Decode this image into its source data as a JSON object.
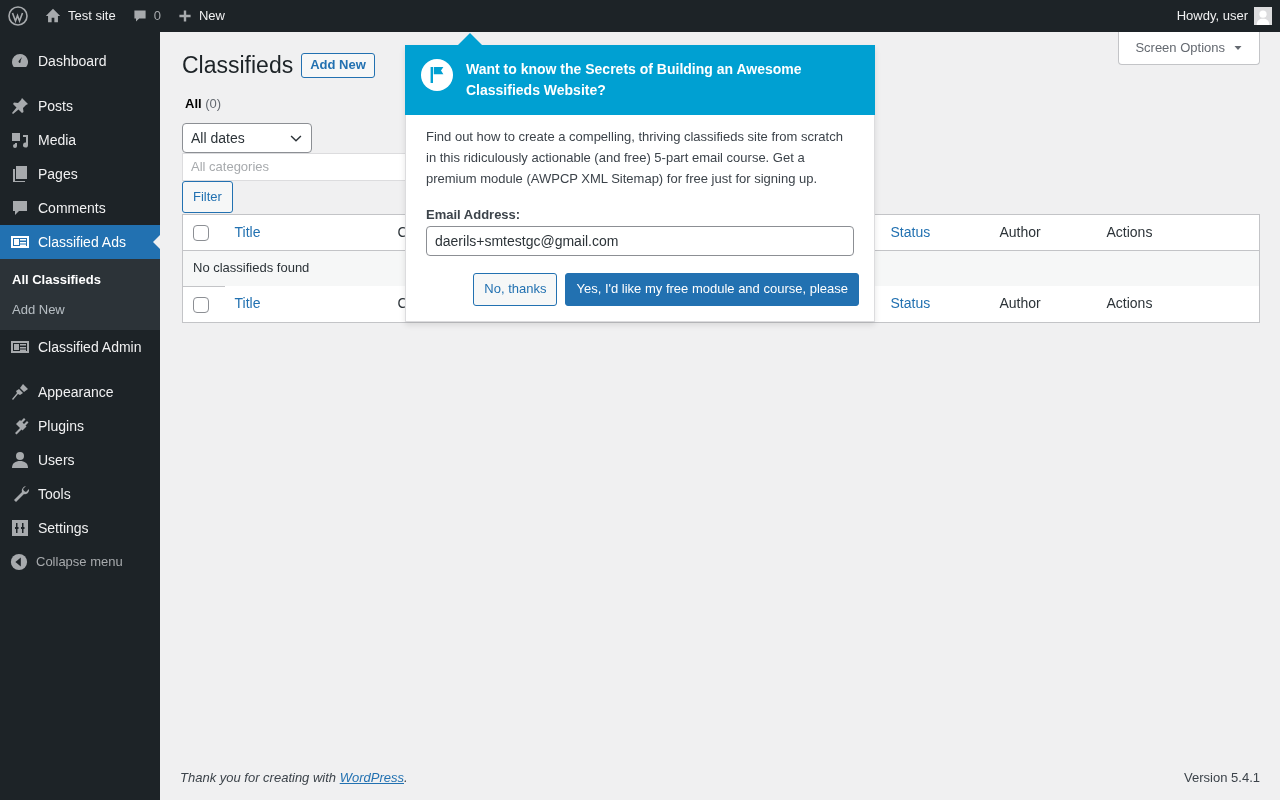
{
  "admin_bar": {
    "site": "Test site",
    "comments": "0",
    "new": "New",
    "greeting": "Howdy, user"
  },
  "menu": [
    {
      "label": "Dashboard",
      "selected": false,
      "gap_after": true
    },
    {
      "label": "Posts",
      "selected": false
    },
    {
      "label": "Media",
      "selected": false
    },
    {
      "label": "Pages",
      "selected": false
    },
    {
      "label": "Comments",
      "selected": false
    },
    {
      "label": "Classified Ads",
      "selected": true,
      "children": [
        {
          "label": "All Classifieds",
          "selected": true
        },
        {
          "label": "Add New",
          "selected": false
        }
      ]
    },
    {
      "label": "Classified Admin",
      "selected": false,
      "gap_after": true
    },
    {
      "label": "Appearance",
      "selected": false
    },
    {
      "label": "Plugins",
      "selected": false
    },
    {
      "label": "Users",
      "selected": false
    },
    {
      "label": "Tools",
      "selected": false
    },
    {
      "label": "Settings",
      "selected": false
    }
  ],
  "collapse_label": "Collapse menu",
  "screen_options": "Screen Options",
  "page": {
    "title": "Classifieds",
    "add_new": "Add New",
    "views": [
      {
        "label": "All",
        "count": "(0)",
        "selected": true
      }
    ],
    "date_filter": "All dates",
    "category_placeholder": "All categories",
    "filter_button": "Filter",
    "table": {
      "columns": [
        {
          "label": "Title",
          "sortable": true
        },
        {
          "label": "C",
          "sortable": false
        },
        {
          "label": "Status",
          "sortable": true
        },
        {
          "label": "Author",
          "sortable": false
        },
        {
          "label": "Actions",
          "sortable": false
        }
      ],
      "header_checked": false,
      "empty_message": "No classifieds found",
      "footer_columns": [
        {
          "label": "Title",
          "sortable": true
        },
        {
          "label": "C",
          "sortable": false
        },
        {
          "label": "Status",
          "sortable": true
        },
        {
          "label": "Author",
          "sortable": false
        },
        {
          "label": "Actions",
          "sortable": false
        }
      ],
      "footer_checked": false
    }
  },
  "popup": {
    "title": "Want to know the Secrets of Building an Awesome Classifieds Website?",
    "body": "Find out how to create a compelling, thriving classifieds site from scratch in this ridiculously actionable (and free) 5-part email course. Get a premium module (AWPCP XML Sitemap) for free just for signing up.",
    "email_label": "Email Address:",
    "email_value": "daerils+smtestgc@gmail.com",
    "buttons": [
      {
        "label": "No, thanks",
        "kind": "secondary"
      },
      {
        "label": "Yes, I'd like my free module and course, please",
        "kind": "primary"
      }
    ]
  },
  "footer": {
    "thanks": "Thank you for creating with ",
    "link": "WordPress",
    "after": ".",
    "version": "Version 5.4.1"
  }
}
